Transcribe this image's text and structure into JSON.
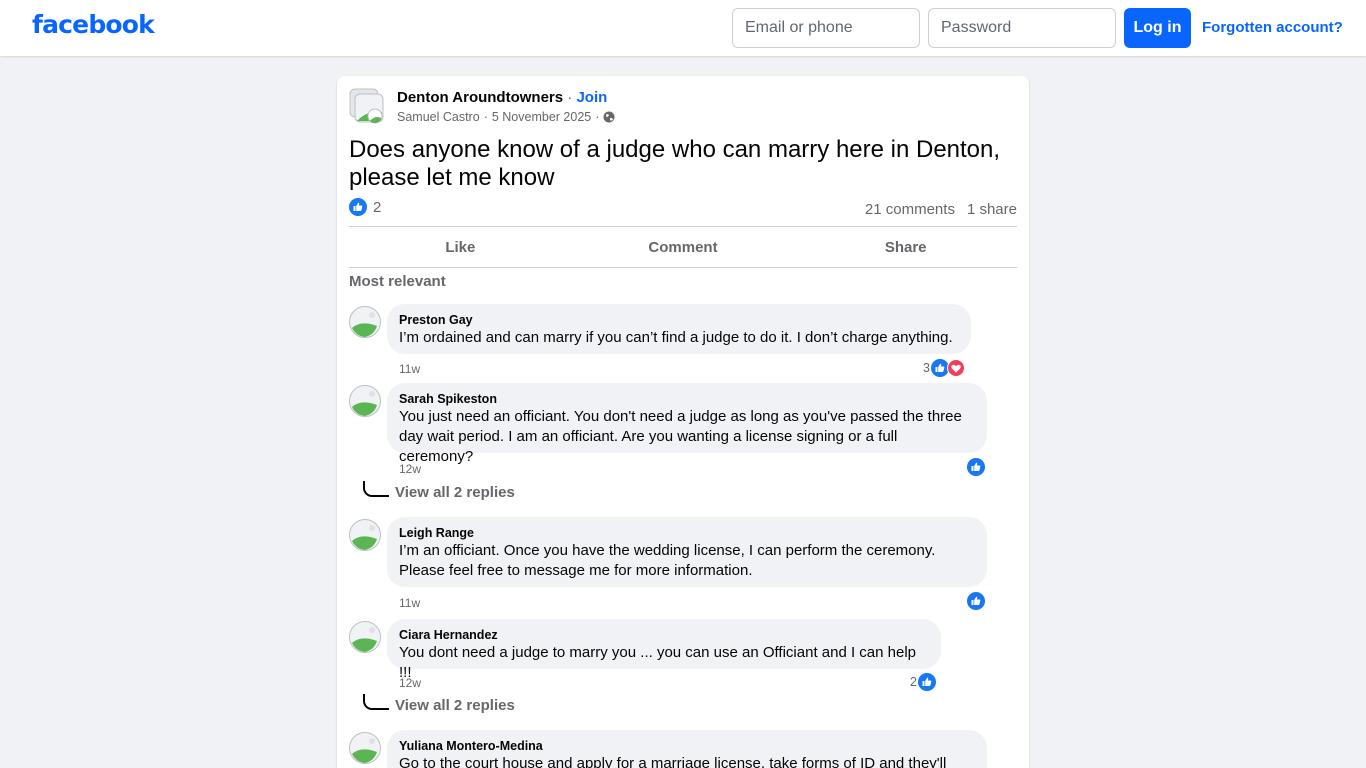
{
  "topbar": {
    "logo": "facebook",
    "email_placeholder": "Email or phone",
    "password_placeholder": "Password",
    "login_label": "Log in",
    "forgot_label": "Forgotten account?"
  },
  "post": {
    "group_name": "Denton Aroundtowners",
    "separator": "·",
    "join_label": "Join",
    "author": "Samuel Castro",
    "date": "5 November 2025",
    "visibility_icon": "globe-icon",
    "text": "Does anyone know of a judge who can marry here in Denton, please let me know",
    "reaction_count": "2",
    "comments_count": "21 comments",
    "shares_count": "1 share",
    "actions": {
      "like": "Like",
      "comment": "Comment",
      "share": "Share"
    },
    "sort_label": "Most relevant"
  },
  "comments": [
    {
      "name": "Preston Gay",
      "text": "I’m ordained and can marry if you can’t find a judge to do it. I don’t charge anything.",
      "time": "11w",
      "reaction_count": "3",
      "reactions": [
        "like",
        "love"
      ]
    },
    {
      "name": "Sarah Spikeston",
      "text": "You just need an officiant. You don't need a judge as long as you've passed the three day wait period. I am an officiant. Are you wanting a license signing or a full ceremony?",
      "time": "12w",
      "reaction_count": "",
      "reactions": [
        "like"
      ],
      "replies_label": "View all 2 replies"
    },
    {
      "name": "Leigh Range",
      "text": "I’m an officiant. Once you have the wedding license, I can perform the ceremony. Please feel free to message me for more information.",
      "time": "11w",
      "reaction_count": "",
      "reactions": [
        "like"
      ]
    },
    {
      "name": "Ciara Hernandez",
      "text": "You dont need a judge to marry you ... you can use an Officiant and I can help !!!",
      "time": "12w",
      "reaction_count": "2",
      "reactions": [
        "like"
      ],
      "replies_label": "View all 2 replies"
    },
    {
      "name": "Yuliana Montero-Medina",
      "text": "Go to the court house and apply for a marriage license, take forms of ID and they'll",
      "time": "",
      "reaction_count": "",
      "reactions": []
    }
  ],
  "colors": {
    "brand": "#0866ff",
    "like": "#1877f2",
    "love": "#f33e58"
  }
}
